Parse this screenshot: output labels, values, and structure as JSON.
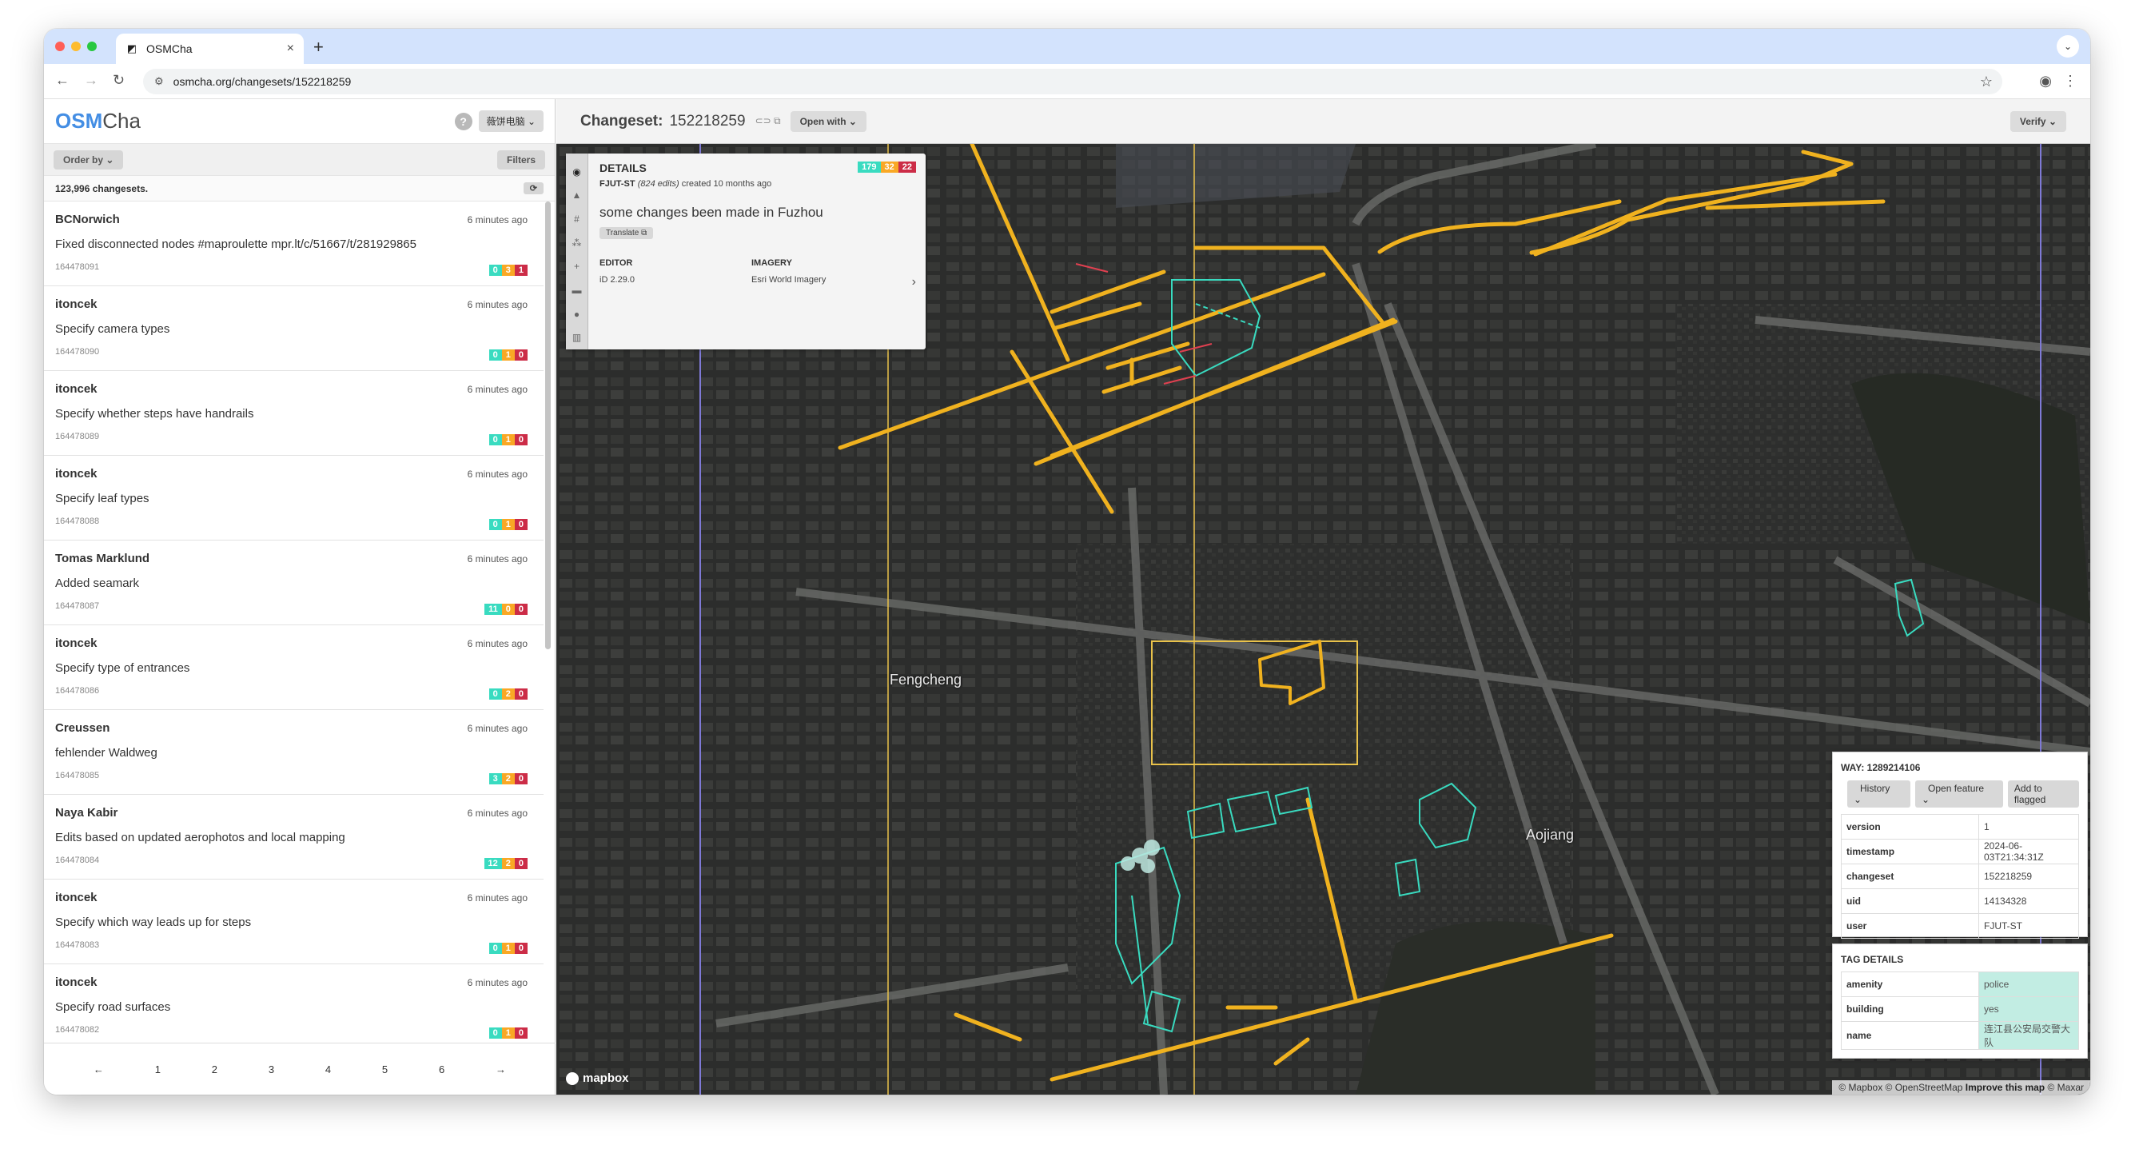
{
  "browser": {
    "tab_title": "OSMCha",
    "url": "osmcha.org/changesets/152218259"
  },
  "sidebar": {
    "logo_main": "OSM",
    "logo_sub": "Cha",
    "help": "?",
    "user_button": "薇饼电脑",
    "order_by": "Order by",
    "filters": "Filters",
    "count_text": "123,996 changesets.",
    "refresh": "⟳",
    "changesets": [
      {
        "user": "BCNorwich",
        "time": "6 minutes ago",
        "comment": "Fixed disconnected nodes #maproulette mpr.lt/c/51667/t/281929865",
        "id": "164478091",
        "create": "0",
        "modify": "3",
        "delete": "1"
      },
      {
        "user": "itoncek",
        "time": "6 minutes ago",
        "comment": "Specify camera types",
        "id": "164478090",
        "create": "0",
        "modify": "1",
        "delete": "0"
      },
      {
        "user": "itoncek",
        "time": "6 minutes ago",
        "comment": "Specify whether steps have handrails",
        "id": "164478089",
        "create": "0",
        "modify": "1",
        "delete": "0"
      },
      {
        "user": "itoncek",
        "time": "6 minutes ago",
        "comment": "Specify leaf types",
        "id": "164478088",
        "create": "0",
        "modify": "1",
        "delete": "0"
      },
      {
        "user": "Tomas Marklund",
        "time": "6 minutes ago",
        "comment": "Added seamark",
        "id": "164478087",
        "create": "11",
        "modify": "0",
        "delete": "0"
      },
      {
        "user": "itoncek",
        "time": "6 minutes ago",
        "comment": "Specify type of entrances",
        "id": "164478086",
        "create": "0",
        "modify": "2",
        "delete": "0"
      },
      {
        "user": "Creussen",
        "time": "6 minutes ago",
        "comment": "fehlender Waldweg",
        "id": "164478085",
        "create": "3",
        "modify": "2",
        "delete": "0"
      },
      {
        "user": "Naya Kabir",
        "time": "6 minutes ago",
        "comment": "Edits based on updated aerophotos and local mapping",
        "id": "164478084",
        "create": "12",
        "modify": "2",
        "delete": "0"
      },
      {
        "user": "itoncek",
        "time": "6 minutes ago",
        "comment": "Specify which way leads up for steps",
        "id": "164478083",
        "create": "0",
        "modify": "1",
        "delete": "0"
      },
      {
        "user": "itoncek",
        "time": "6 minutes ago",
        "comment": "Specify road surfaces",
        "id": "164478082",
        "create": "0",
        "modify": "1",
        "delete": "0"
      }
    ],
    "pager": [
      "←",
      "1",
      "2",
      "3",
      "4",
      "5",
      "6",
      "→"
    ]
  },
  "main": {
    "changeset_label": "Changeset:",
    "changeset_id": "152218259",
    "open_with": "Open with",
    "verify": "Verify"
  },
  "details": {
    "title": "DETAILS",
    "badges": {
      "create": "179",
      "modify": "32",
      "delete": "22"
    },
    "user": "FJUT-ST",
    "edits": "(824 edits)",
    "created": "created 10 months ago",
    "comment": "some changes been made in Fuzhou",
    "translate": "Translate",
    "editor_label": "EDITOR",
    "editor_value": "iD 2.29.0",
    "imagery_label": "IMAGERY",
    "imagery_value": "Esri World Imagery",
    "next": "›"
  },
  "map": {
    "labels": {
      "fengcheng": "Fengcheng",
      "aojiang": "Aojiang"
    },
    "mapbox": "mapbox",
    "attribution_a": "© Mapbox © OpenStreetMap",
    "attribution_b": "Improve this map",
    "attribution_c": "© Maxar"
  },
  "feature": {
    "way_title": "WAY: 1289214106",
    "history": "History",
    "open_feature": "Open feature",
    "add_flagged": "Add to flagged",
    "props": [
      {
        "k": "version",
        "v": "1"
      },
      {
        "k": "timestamp",
        "v": "2024-06-03T21:34:31Z"
      },
      {
        "k": "changeset",
        "v": "152218259"
      },
      {
        "k": "uid",
        "v": "14134328"
      },
      {
        "k": "user",
        "v": "FJUT-ST"
      }
    ],
    "tag_title": "TAG DETAILS",
    "tags": [
      {
        "k": "amenity",
        "v": "police"
      },
      {
        "k": "building",
        "v": "yes"
      },
      {
        "k": "name",
        "v": "连江县公安局交警大队"
      }
    ]
  },
  "colors": {
    "create": "#39dbc0",
    "modify": "#f9a825",
    "delete": "#cc2c47",
    "road": "#f0b21f",
    "building": "#39dbc0",
    "accent": "#448ee4"
  }
}
